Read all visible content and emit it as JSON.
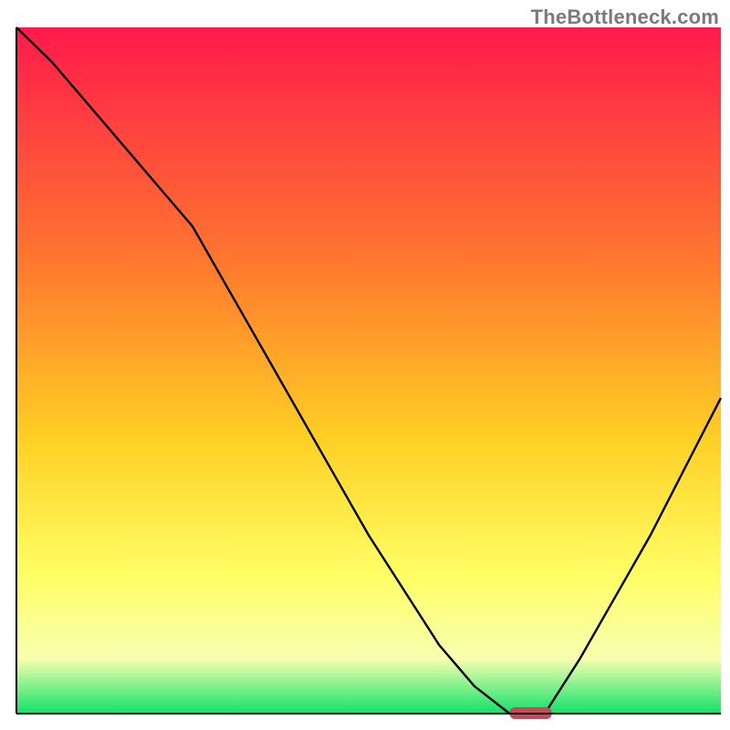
{
  "watermark": "TheBottleneck.com",
  "colors": {
    "gradient_top": "#ff1a4b",
    "gradient_mid1": "#ff7a2e",
    "gradient_mid2": "#ffd024",
    "gradient_mid3": "#ffff66",
    "gradient_mid4": "#f7ffb0",
    "gradient_bottom": "#10e26a",
    "axis": "#000000",
    "curve": "#000000",
    "marker": "#c9495a"
  },
  "chart_data": {
    "type": "line",
    "title": "",
    "xlabel": "",
    "ylabel": "",
    "xlim": [
      0,
      100
    ],
    "ylim": [
      0,
      100
    ],
    "x": [
      0,
      5,
      10,
      15,
      20,
      25,
      30,
      35,
      40,
      45,
      50,
      55,
      60,
      65,
      70,
      73,
      75,
      80,
      85,
      90,
      95,
      100
    ],
    "values": [
      100,
      95,
      89,
      83,
      77,
      71,
      62,
      53,
      44,
      35,
      26,
      18,
      10,
      4,
      0,
      0,
      0,
      8,
      17,
      26,
      36,
      46
    ],
    "series": [
      {
        "name": "bottleneck-curve",
        "x": [
          0,
          5,
          10,
          15,
          20,
          25,
          30,
          35,
          40,
          45,
          50,
          55,
          60,
          65,
          70,
          73,
          75,
          80,
          85,
          90,
          95,
          100
        ],
        "values": [
          100,
          95,
          89,
          83,
          77,
          71,
          62,
          53,
          44,
          35,
          26,
          18,
          10,
          4,
          0,
          0,
          0,
          8,
          17,
          26,
          36,
          46
        ]
      }
    ],
    "marker": {
      "x": 73,
      "y": 0,
      "width": 6,
      "height": 2
    },
    "annotations": []
  }
}
